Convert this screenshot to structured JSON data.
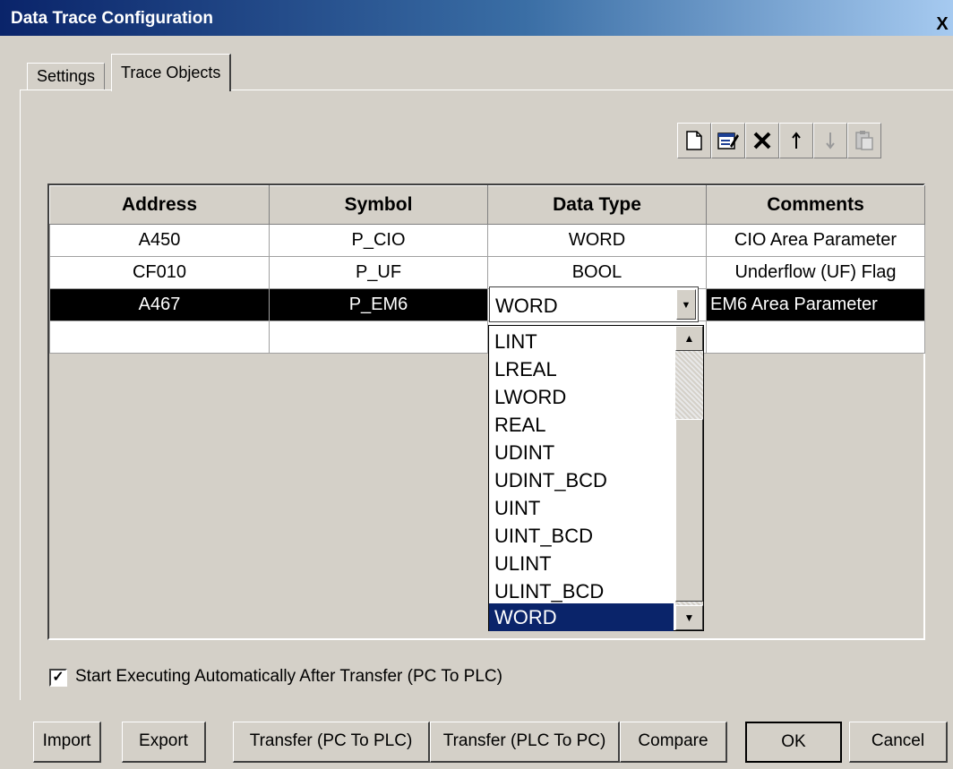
{
  "window": {
    "title": "Data Trace Configuration",
    "close": "X"
  },
  "tabs": [
    {
      "label": "Settings",
      "active": false
    },
    {
      "label": "Trace Objects",
      "active": true
    }
  ],
  "toolbar": {
    "icons": [
      "new-icon",
      "edit-icon",
      "delete-icon",
      "move-up-icon",
      "move-down-icon",
      "paste-icon"
    ]
  },
  "grid": {
    "columns": [
      "Address",
      "Symbol",
      "Data Type",
      "Comments"
    ],
    "rows": [
      {
        "address": "A450",
        "symbol": "P_CIO",
        "data_type": "WORD",
        "comment": "CIO Area Parameter"
      },
      {
        "address": "CF010",
        "symbol": "P_UF",
        "data_type": "BOOL",
        "comment": "Underflow (UF) Flag"
      },
      {
        "address": "A467",
        "symbol": "P_EM6",
        "data_type": "WORD",
        "comment": "EM6 Area Parameter"
      }
    ]
  },
  "dropdown": {
    "value": "WORD",
    "options": [
      "LINT",
      "LREAL",
      "LWORD",
      "REAL",
      "UDINT",
      "UDINT_BCD",
      "UINT",
      "UINT_BCD",
      "ULINT",
      "ULINT_BCD",
      "WORD"
    ],
    "selected": "WORD"
  },
  "auto_start": {
    "label": "Start Executing Automatically After Transfer (PC To PLC)",
    "checked": true
  },
  "buttons": {
    "import": "Import",
    "export": "Export",
    "transfer_pc_to_plc": "Transfer (PC To PLC)",
    "transfer_plc_to_pc": "Transfer (PLC To PC)",
    "compare": "Compare",
    "ok": "OK",
    "cancel": "Cancel"
  },
  "colors": {
    "titlebar": "#0a246a",
    "selection": "#0a246a",
    "face": "#d4d0c8"
  }
}
